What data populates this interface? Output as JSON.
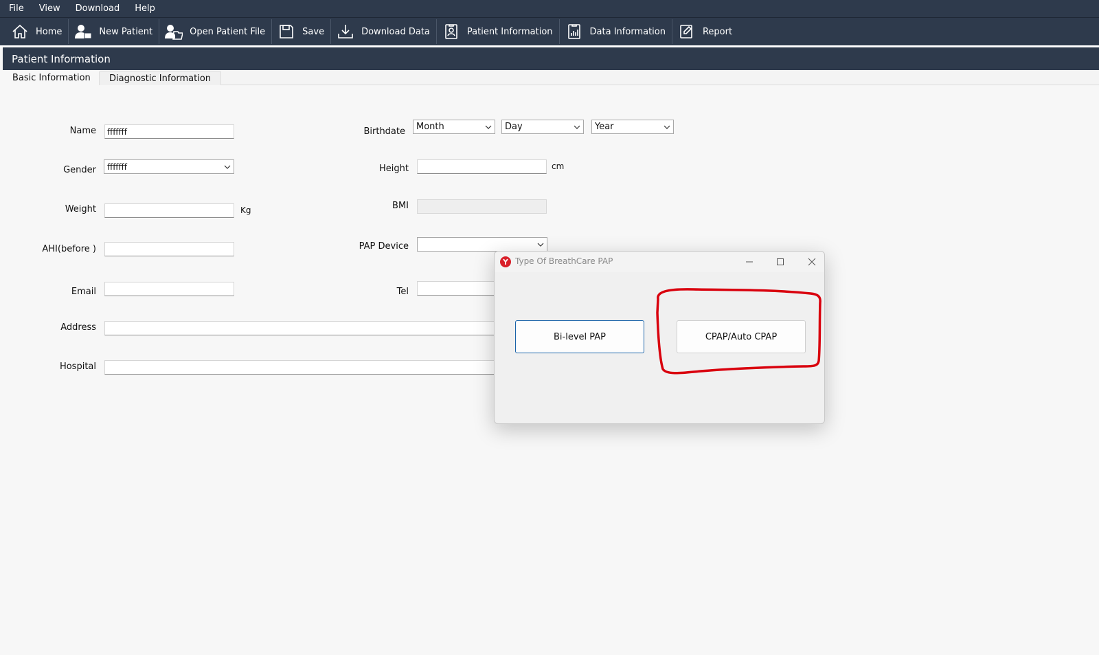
{
  "menu": [
    "File",
    "View",
    "Download",
    "Help"
  ],
  "toolbar": {
    "home": "Home",
    "new_patient": "New Patient",
    "open_patient_file": "Open Patient File",
    "save": "Save",
    "download_data": "Download Data",
    "patient_information": "Patient Information",
    "data_information": "Data Information",
    "report": "Report"
  },
  "panel": {
    "title": "Patient Information"
  },
  "tabs": {
    "basic": "Basic Information",
    "diagnostic": "Diagnostic Information"
  },
  "form": {
    "name": {
      "label": "Name",
      "value": "fffffff"
    },
    "gender": {
      "label": "Gender",
      "value": "fffffff"
    },
    "weight": {
      "label": "Weight",
      "value": "",
      "unit": "Kg"
    },
    "ahi": {
      "label": "AHI(before )",
      "value": ""
    },
    "email": {
      "label": "Email",
      "value": ""
    },
    "address": {
      "label": "Address",
      "value": ""
    },
    "hospital": {
      "label": "Hospital",
      "value": ""
    },
    "birthdate": {
      "label": "Birthdate",
      "month": "Month",
      "day": "Day",
      "year": "Year"
    },
    "height": {
      "label": "Height",
      "value": "",
      "unit": "cm"
    },
    "bmi": {
      "label": "BMI",
      "value": ""
    },
    "pap_device": {
      "label": "PAP Device",
      "value": ""
    },
    "tel": {
      "label": "Tel",
      "value": ""
    }
  },
  "dialog": {
    "title": "Type Of BreathCare PAP",
    "option_bilevel": "Bi-level PAP",
    "option_cpap": "CPAP/Auto CPAP"
  },
  "colors": {
    "header_bg": "#2e3a4c",
    "annotation": "#d9000d",
    "focus_border": "#1a63a8",
    "app_icon": "#d9202a"
  }
}
